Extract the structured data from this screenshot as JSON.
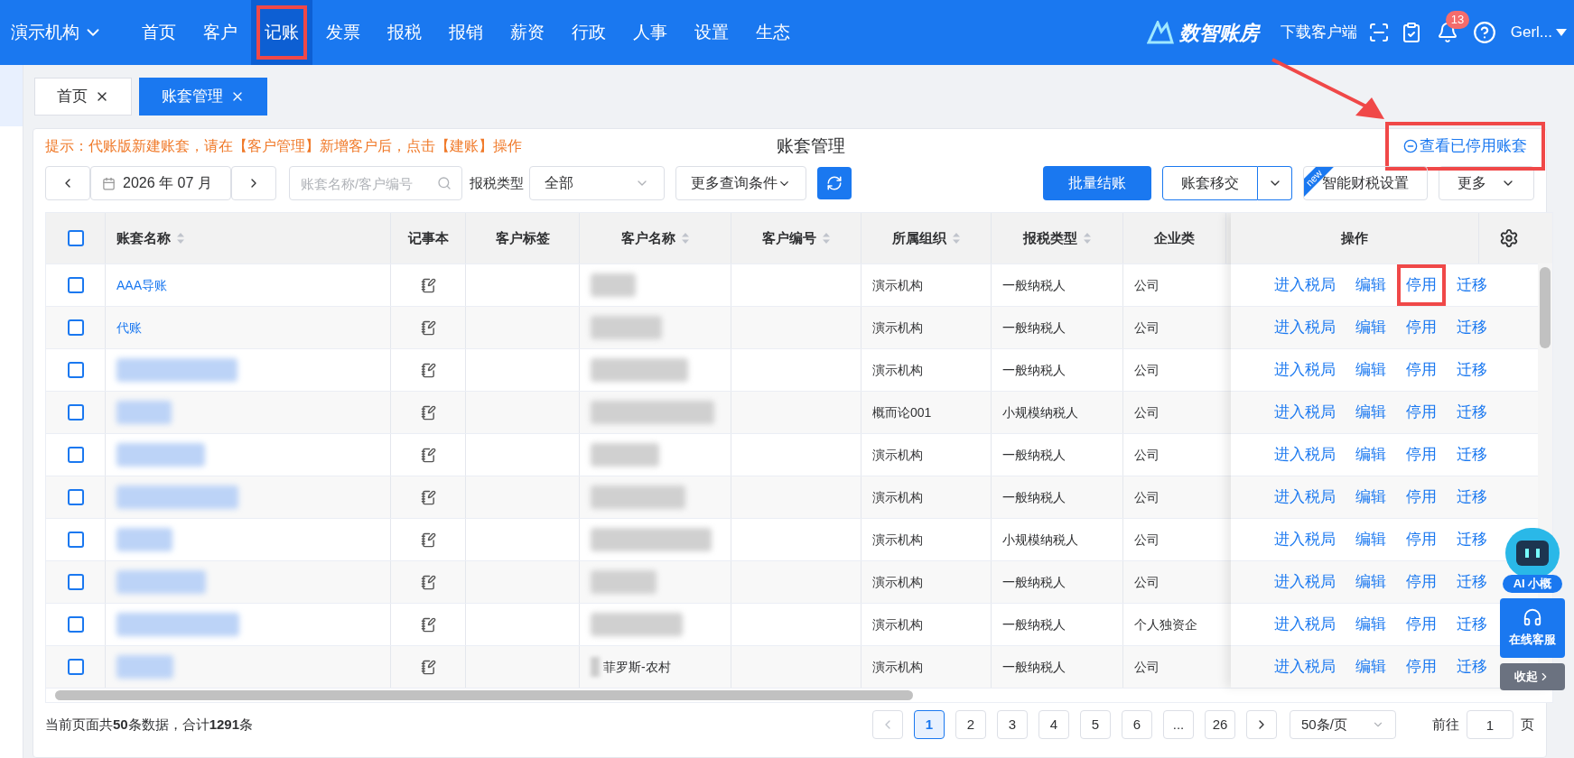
{
  "topbar": {
    "org": "演示机构",
    "nav": [
      {
        "label": "首页",
        "selected": false,
        "annotated": false
      },
      {
        "label": "客户",
        "selected": false,
        "annotated": false
      },
      {
        "label": "记账",
        "selected": true,
        "annotated": true
      },
      {
        "label": "发票",
        "selected": false,
        "annotated": false
      },
      {
        "label": "报税",
        "selected": false,
        "annotated": false
      },
      {
        "label": "报销",
        "selected": false,
        "annotated": false
      },
      {
        "label": "薪资",
        "selected": false,
        "annotated": false
      },
      {
        "label": "行政",
        "selected": false,
        "annotated": false
      },
      {
        "label": "人事",
        "selected": false,
        "annotated": false
      },
      {
        "label": "设置",
        "selected": false,
        "annotated": false
      },
      {
        "label": "生态",
        "selected": false,
        "annotated": false
      }
    ],
    "brand": "数智账房",
    "download": "下载客户端",
    "notification_count": "13",
    "user": "Gerl..."
  },
  "tabs": [
    {
      "label": "首页",
      "selected": false
    },
    {
      "label": "账套管理",
      "selected": true
    }
  ],
  "page": {
    "hint": "提示：代账版新建账套，请在【客户管理】新增客户后，点击【建账】操作",
    "title": "账套管理",
    "disabled_link": {
      "label": "查看已停用账套",
      "annotated": true
    }
  },
  "filters": {
    "month": "2026 年 07 月",
    "search_placeholder": "账套名称/客户编号",
    "tax_type_label": "报税类型",
    "tax_type": "全部",
    "more_conditions": "更多查询条件"
  },
  "actions": {
    "batch_close": "批量结账",
    "transfer": "账套移交",
    "smart_settings": "智能财税设置",
    "new_badge": "new",
    "more": "更多"
  },
  "table": {
    "select_all_checked": false,
    "columns": [
      {
        "label": "账套名称",
        "sortable": true
      },
      {
        "label": "记事本",
        "sortable": false
      },
      {
        "label": "客户标签",
        "sortable": false
      },
      {
        "label": "客户名称",
        "sortable": true
      },
      {
        "label": "客户编号",
        "sortable": true
      },
      {
        "label": "所属组织",
        "sortable": true
      },
      {
        "label": "报税类型",
        "sortable": true
      },
      {
        "label": "企业类",
        "sortable": false
      },
      {
        "label": "操作",
        "sortable": false
      }
    ],
    "rows": [
      {
        "name": "AAA导账",
        "org": "演示机构",
        "tax_type": "一般纳税人",
        "company_type": "公司",
        "checked": false,
        "actions": [
          {
            "label": "进入税局",
            "annotated": false
          },
          {
            "label": "编辑",
            "annotated": false
          },
          {
            "label": "停用",
            "annotated": true
          },
          {
            "label": "迁移",
            "annotated": false
          }
        ]
      },
      {
        "name": "代账",
        "org": "演示机构",
        "tax_type": "一般纳税人",
        "company_type": "公司",
        "checked": false,
        "actions": [
          {
            "label": "进入税局",
            "annotated": false
          },
          {
            "label": "编辑",
            "annotated": false
          },
          {
            "label": "停用",
            "annotated": false
          },
          {
            "label": "迁移",
            "annotated": false
          }
        ]
      },
      {
        "org": "演示机构",
        "tax_type": "一般纳税人",
        "company_type": "公司",
        "checked": false,
        "actions": [
          {
            "label": "进入税局",
            "annotated": false
          },
          {
            "label": "编辑",
            "annotated": false
          },
          {
            "label": "停用",
            "annotated": false
          },
          {
            "label": "迁移",
            "annotated": false
          }
        ]
      },
      {
        "org": "概而论001",
        "tax_type": "小规模纳税人",
        "company_type": "公司",
        "checked": false,
        "actions": [
          {
            "label": "进入税局",
            "annotated": false
          },
          {
            "label": "编辑",
            "annotated": false
          },
          {
            "label": "停用",
            "annotated": false
          },
          {
            "label": "迁移",
            "annotated": false
          }
        ]
      },
      {
        "org": "演示机构",
        "tax_type": "一般纳税人",
        "company_type": "公司",
        "checked": false,
        "actions": [
          {
            "label": "进入税局",
            "annotated": false
          },
          {
            "label": "编辑",
            "annotated": false
          },
          {
            "label": "停用",
            "annotated": false
          },
          {
            "label": "迁移",
            "annotated": false
          }
        ]
      },
      {
        "org": "演示机构",
        "tax_type": "一般纳税人",
        "company_type": "公司",
        "checked": false,
        "actions": [
          {
            "label": "进入税局",
            "annotated": false
          },
          {
            "label": "编辑",
            "annotated": false
          },
          {
            "label": "停用",
            "annotated": false
          },
          {
            "label": "迁移",
            "annotated": false
          }
        ]
      },
      {
        "org": "演示机构",
        "tax_type": "小规模纳税人",
        "company_type": "公司",
        "checked": false,
        "actions": [
          {
            "label": "进入税局",
            "annotated": false
          },
          {
            "label": "编辑",
            "annotated": false
          },
          {
            "label": "停用",
            "annotated": false
          },
          {
            "label": "迁移",
            "annotated": false
          }
        ]
      },
      {
        "org": "演示机构",
        "tax_type": "一般纳税人",
        "company_type": "公司",
        "checked": false,
        "actions": [
          {
            "label": "进入税局",
            "annotated": false
          },
          {
            "label": "编辑",
            "annotated": false
          },
          {
            "label": "停用",
            "annotated": false
          },
          {
            "label": "迁移",
            "annotated": false
          }
        ]
      },
      {
        "org": "演示机构",
        "tax_type": "一般纳税人",
        "company_type": "个人独资企",
        "checked": false,
        "actions": [
          {
            "label": "进入税局",
            "annotated": false
          },
          {
            "label": "编辑",
            "annotated": false
          },
          {
            "label": "停用",
            "annotated": false
          },
          {
            "label": "迁移",
            "annotated": false
          }
        ]
      },
      {
        "customer": "菲罗斯-农村",
        "org": "演示机构",
        "tax_type": "一般纳税人",
        "company_type": "公司",
        "checked": false,
        "actions": [
          {
            "label": "进入税局",
            "annotated": false
          },
          {
            "label": "编辑",
            "annotated": false
          },
          {
            "label": "停用",
            "annotated": false
          },
          {
            "label": "迁移",
            "annotated": false
          }
        ]
      }
    ]
  },
  "footer": {
    "summary": "当前页面共**50**条数据，合计**1291**条",
    "pages": [
      {
        "label": "1",
        "selected": true
      },
      {
        "label": "2",
        "selected": false
      },
      {
        "label": "3",
        "selected": false
      },
      {
        "label": "4",
        "selected": false
      },
      {
        "label": "5",
        "selected": false
      },
      {
        "label": "6",
        "selected": false
      },
      {
        "label": "...",
        "selected": false
      },
      {
        "label": "26",
        "selected": false
      }
    ],
    "page_size": "50条/页",
    "goto_label": "前往",
    "goto_value": "1",
    "goto_suffix": "页"
  },
  "widgets": {
    "ai": "AI 小概",
    "service": "在线客服",
    "collapse": "收起"
  }
}
